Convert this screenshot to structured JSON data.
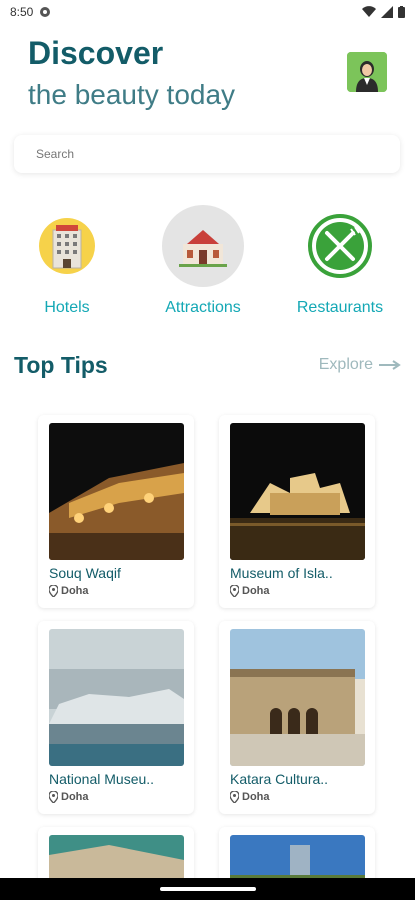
{
  "status": {
    "time": "8:50"
  },
  "header": {
    "title": "Discover",
    "subtitle": "the beauty today"
  },
  "search": {
    "placeholder": "Search"
  },
  "categories": [
    {
      "label": "Hotels",
      "icon": "hotel-icon"
    },
    {
      "label": "Attractions",
      "icon": "attraction-icon"
    },
    {
      "label": "Restaurants",
      "icon": "restaurant-icon"
    }
  ],
  "tips": {
    "title": "Top Tips",
    "explore_label": "Explore",
    "items": [
      {
        "name": "Souq Waqif",
        "location": "Doha"
      },
      {
        "name": "Museum of Isla..",
        "location": "Doha"
      },
      {
        "name": "National Museu..",
        "location": "Doha"
      },
      {
        "name": "Katara Cultura..",
        "location": "Doha"
      }
    ]
  },
  "colors": {
    "primary": "#135c68",
    "accent": "#14a8b5"
  }
}
